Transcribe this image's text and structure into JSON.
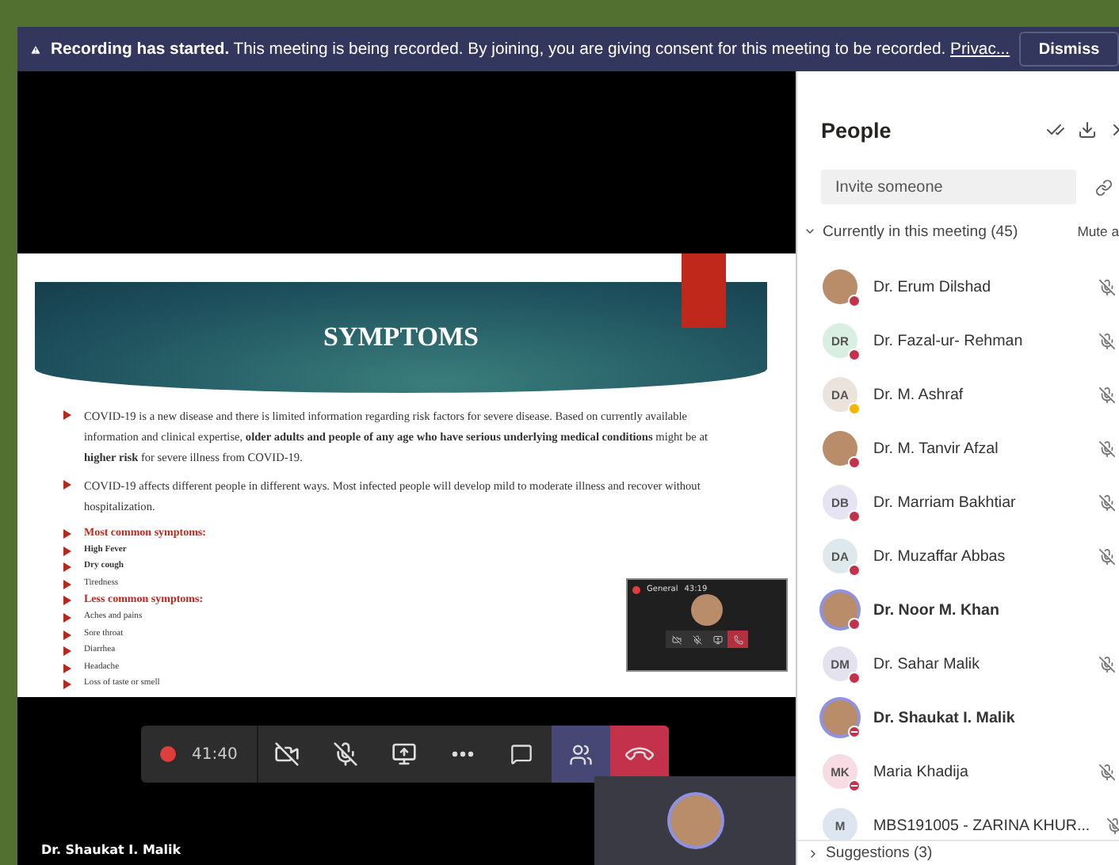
{
  "banner": {
    "title": "Recording has started.",
    "message": "This meeting is being recorded. By joining, you are giving consent for this meeting to be recorded.",
    "link": "Privac...",
    "button": "Dismiss"
  },
  "slide": {
    "title": "SYMPTOMS",
    "bullets": [
      {
        "kind": "paragraph",
        "text": "COVID-19 is a new disease and there is limited information regarding risk factors for severe disease. Based on currently available information and clinical expertise, **older adults and people of any age who have serious underlying medical conditions** might be at **higher risk** for severe illness from COVID-19."
      },
      {
        "kind": "paragraph",
        "text": "COVID-19 affects different people in different ways. Most infected people will develop mild to moderate illness and recover without hospitalization."
      },
      {
        "kind": "heading",
        "text": "Most common symptoms:"
      },
      {
        "kind": "strong_item",
        "text": "High Fever"
      },
      {
        "kind": "strong_item",
        "text": "Dry cough"
      },
      {
        "kind": "item",
        "text": "Tiredness"
      },
      {
        "kind": "heading",
        "text": "Less common symptoms:"
      },
      {
        "kind": "item",
        "text": "Aches and pains"
      },
      {
        "kind": "item",
        "text": "Sore throat"
      },
      {
        "kind": "item",
        "text": "Diarrhea"
      },
      {
        "kind": "item",
        "text": "Headache"
      },
      {
        "kind": "item",
        "text": "Loss of taste or smell"
      }
    ]
  },
  "mini_call": {
    "channel": "General",
    "time": "43:19"
  },
  "toolbar": {
    "time": "41:40",
    "buttons": [
      {
        "kind": "camera",
        "selected": false
      },
      {
        "kind": "mic",
        "selected": false
      },
      {
        "kind": "share",
        "selected": false
      },
      {
        "kind": "more",
        "selected": false
      },
      {
        "kind": "chat",
        "selected": false
      },
      {
        "kind": "people",
        "selected": true
      },
      {
        "kind": "hangup",
        "selected": false
      }
    ]
  },
  "stage_name": "Dr. Shaukat I. Malik",
  "people": {
    "title": "People",
    "invite_placeholder": "Invite someone",
    "section": {
      "label": "Currently in this meeting (45)",
      "expanded": true
    },
    "mute_all": "Mute a",
    "participants": [
      {
        "name": "Dr. Erum Dilshad",
        "kind": "photo",
        "presence": {
          "kind": "busy",
          "color": "#c4314b"
        },
        "muted": true,
        "highlighted": false
      },
      {
        "name": "Dr. Fazal-ur- Rehman",
        "kind": "initials",
        "initials": "DR",
        "color": "#d9efe2",
        "presence": {
          "kind": "busy",
          "color": "#c4314b"
        },
        "muted": true,
        "highlighted": false
      },
      {
        "name": "Dr. M. Ashraf",
        "kind": "initials",
        "initials": "DA",
        "color": "#ebe3dc",
        "presence": {
          "kind": "away",
          "color": "#f8b400"
        },
        "muted": true,
        "highlighted": false
      },
      {
        "name": "Dr. M. Tanvir Afzal",
        "kind": "photo",
        "presence": {
          "kind": "busy",
          "color": "#c4314b"
        },
        "muted": true,
        "highlighted": false
      },
      {
        "name": "Dr. Marriam Bakhtiar",
        "kind": "initials",
        "initials": "DB",
        "color": "#e6e3f3",
        "presence": {
          "kind": "busy",
          "color": "#c4314b"
        },
        "muted": true,
        "highlighted": false
      },
      {
        "name": "Dr. Muzaffar Abbas",
        "kind": "initials",
        "initials": "DA",
        "color": "#dde9ed",
        "presence": {
          "kind": "busy",
          "color": "#c4314b"
        },
        "muted": true,
        "highlighted": false
      },
      {
        "name": "Dr. Noor M. Khan",
        "kind": "photo",
        "presence": {
          "kind": "busy",
          "color": "#c4314b"
        },
        "muted": false,
        "highlighted": true
      },
      {
        "name": "Dr. Sahar Malik",
        "kind": "initials",
        "initials": "DM",
        "color": "#e5e2f0",
        "presence": {
          "kind": "busy",
          "color": "#c4314b"
        },
        "muted": true,
        "highlighted": false
      },
      {
        "name": "Dr. Shaukat I. Malik",
        "kind": "photo",
        "presence": {
          "kind": "dnd",
          "color": "#c4314b"
        },
        "muted": false,
        "highlighted": true
      },
      {
        "name": "Maria Khadija",
        "kind": "initials",
        "initials": "MK",
        "color": "#f7dce4",
        "presence": {
          "kind": "dnd",
          "color": "#c4314b"
        },
        "muted": true,
        "highlighted": false
      },
      {
        "name": "MBS191005 - ZARINA KHUR...",
        "kind": "initials",
        "initials": "M",
        "color": "#dce5f0",
        "muted": true,
        "highlighted": false
      }
    ],
    "suggestions": {
      "label": "Suggestions (3)",
      "expanded": false
    }
  }
}
